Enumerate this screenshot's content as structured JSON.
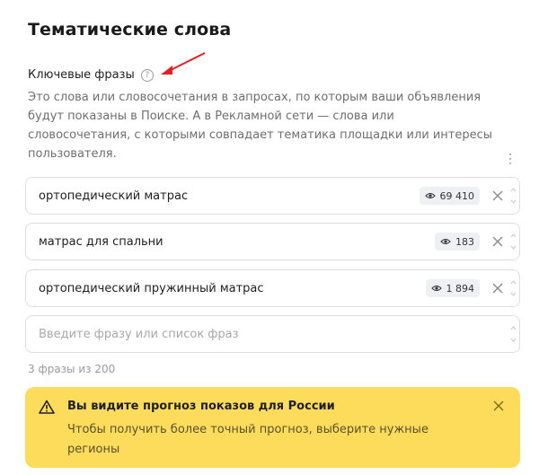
{
  "section": {
    "title": "Тематические слова",
    "keyphrases_label": "Ключевые фразы",
    "help_icon_glyph": "?",
    "description": "Это слова или словосочетания в запросах, по которым ваши объявления будут показаны в Поиске. А в Рекламной сети — слова или словосочетания, с которыми совпадает тематика площадки или интересы пользователя."
  },
  "phrases": [
    {
      "text": "ортопедический матрас",
      "impressions": "69 410"
    },
    {
      "text": "матрас для спальни",
      "impressions": "183"
    },
    {
      "text": "ортопедический пружинный матрас",
      "impressions": "1 894"
    }
  ],
  "input": {
    "placeholder": "Введите фразу или список фраз"
  },
  "counter": "3 фразы из 200",
  "forecast_notice": {
    "title": "Вы видите прогноз показов для России",
    "text": "Чтобы получить более точный прогноз, выберите нужные регионы",
    "background": "#fedc5b"
  },
  "annotation_arrow_color": "#e02020"
}
